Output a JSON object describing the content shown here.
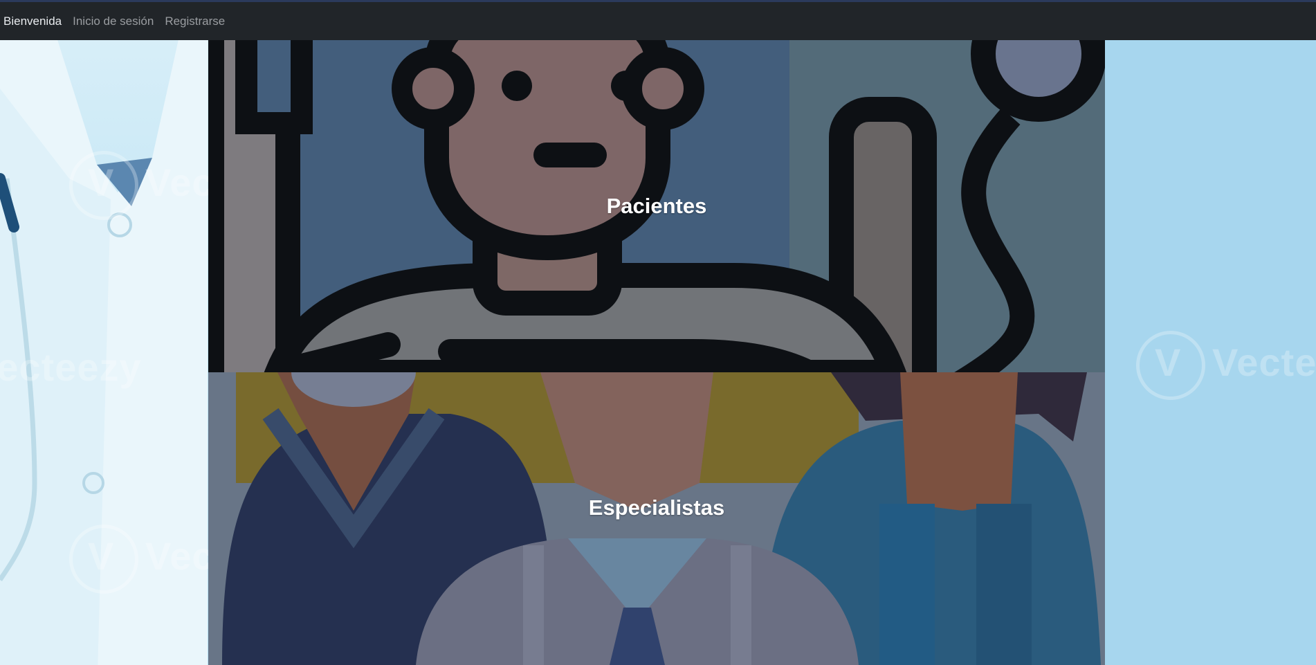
{
  "navbar": {
    "links": [
      {
        "label": "Bienvenida",
        "active": true
      },
      {
        "label": "Inicio de sesión",
        "active": false
      },
      {
        "label": "Registrarse",
        "active": false
      }
    ]
  },
  "background": {
    "watermark_text": "Vecteezy"
  },
  "panels": {
    "patients": {
      "title": "Pacientes",
      "icon": "patient-in-bed-icon"
    },
    "specialists": {
      "title": "Especialistas",
      "icon": "medical-team-icon"
    }
  },
  "colors": {
    "navbar_bg": "#212529",
    "page_bg": "#a7d6ee",
    "panel_text": "#ffffff"
  }
}
